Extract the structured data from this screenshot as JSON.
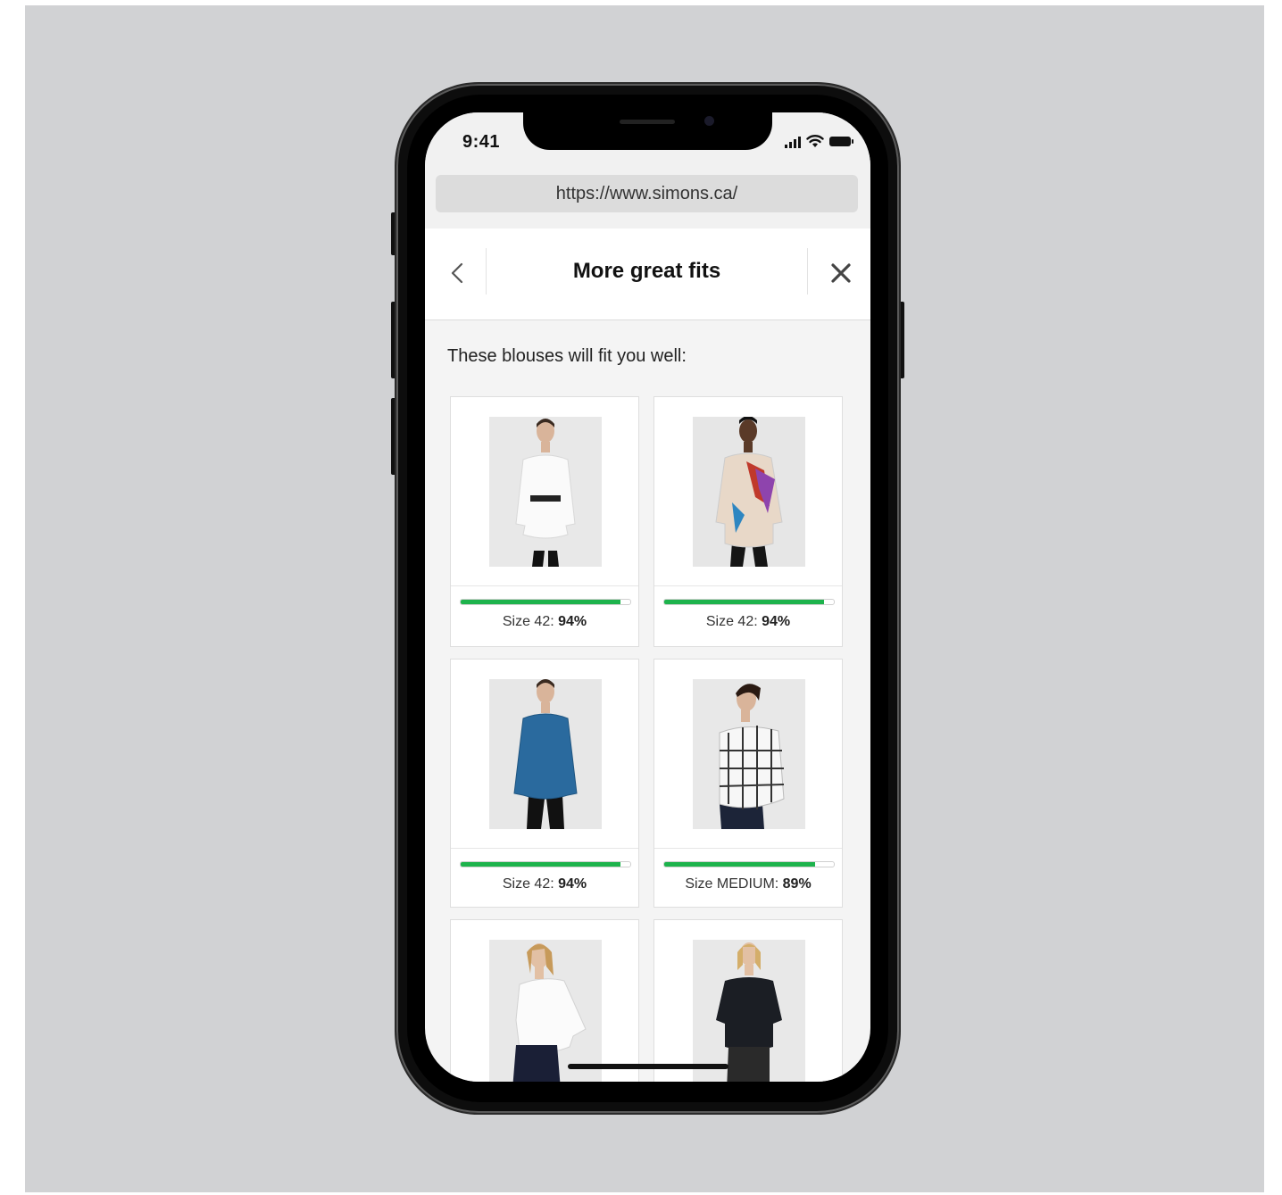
{
  "status_bar": {
    "time": "9:41"
  },
  "browser": {
    "url": "https://www.simons.ca/"
  },
  "header": {
    "title": "More great fits"
  },
  "intro": "These blouses will fit you well:",
  "products": [
    {
      "size_prefix": "Size 42: ",
      "fit": "94%",
      "fit_fraction": 0.94,
      "photo": "white-belted-blouse"
    },
    {
      "size_prefix": "Size 42: ",
      "fit": "94%",
      "fit_fraction": 0.94,
      "photo": "floral-print-blouse"
    },
    {
      "size_prefix": "Size 42: ",
      "fit": "94%",
      "fit_fraction": 0.94,
      "photo": "blue-denim-blouse"
    },
    {
      "size_prefix": "Size MEDIUM: ",
      "fit": "89%",
      "fit_fraction": 0.89,
      "photo": "windowpane-check-shirt"
    },
    {
      "photo": "white-button-shirt"
    },
    {
      "photo": "black-tie-neck-blouse"
    }
  ],
  "colors": {
    "fit_bar": "#1db34c",
    "backdrop": "#d1d2d4"
  }
}
